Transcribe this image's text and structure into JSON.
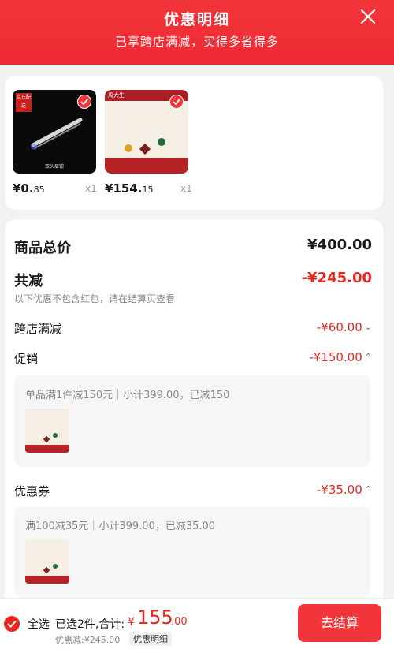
{
  "header": {
    "title": "优惠明细",
    "subtitle": "已享跨店满减，买得多省得多"
  },
  "products": [
    {
      "price_int": "¥0.",
      "price_dec": "85",
      "qty": "x1",
      "badge_text": "京东配送",
      "caption": "双头眉钳"
    },
    {
      "price_int": "¥154.",
      "price_dec": "15",
      "qty": "x1",
      "badge_text": "周大生",
      "caption": ""
    }
  ],
  "summary": {
    "total_label": "商品总价",
    "total_value": "¥400.00",
    "reduce_label": "共减",
    "reduce_value": "-¥245.00",
    "reduce_note": "以下优惠不包含红包，请在结算页查看"
  },
  "items": [
    {
      "label": "跨店满减",
      "value": "-¥60.00"
    },
    {
      "label": "促销",
      "value": "-¥150.00",
      "desc": "单品满1件减150元｜小计399.00，已减150"
    },
    {
      "label": "优惠券",
      "value": "-¥35.00",
      "desc": "满100减35元｜小计399.00，已减35.00"
    }
  ],
  "footer": {
    "all_label": "全选",
    "selected_text": "已选2件,合计:",
    "currency": "¥",
    "total_int": "155",
    "total_dec": ".00",
    "discount_text": "优惠减:¥245.00",
    "detail_btn": "优惠明细",
    "checkout_btn": "去结算"
  },
  "colors": {
    "brand_red": "#f2353a",
    "price_red": "#e8261d"
  }
}
